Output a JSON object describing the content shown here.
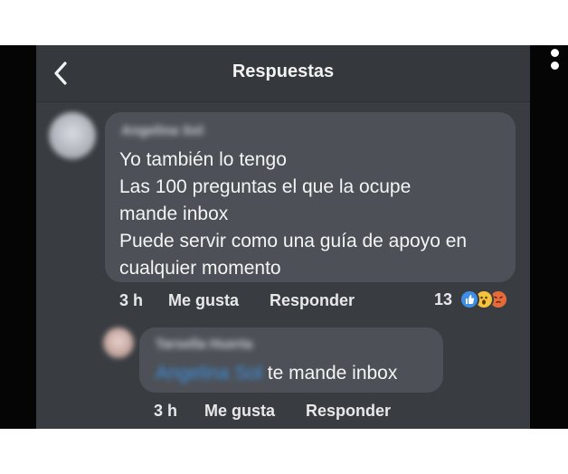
{
  "header": {
    "title": "Respuestas",
    "back_icon": "chevron-left-icon"
  },
  "comment": {
    "author_name": "Angelina Sol",
    "lines": [
      "Yo también lo tengo",
      "Las 100 preguntas el que la ocupe",
      "mande inbox",
      "Puede servir como una guía de apoyo en",
      "cualquier momento"
    ],
    "time": "3 h",
    "like_label": "Me gusta",
    "reply_label": "Responder",
    "reaction_count": "13",
    "reactions": [
      "like",
      "wow",
      "angry"
    ]
  },
  "reply": {
    "author_name": "Tarsella Huerta",
    "mention": "Angelina Sol",
    "text": "te mande inbox",
    "time": "3 h",
    "like_label": "Me gusta",
    "reply_label": "Responder"
  },
  "colors": {
    "screen_bg": "#393d42",
    "bubble_bg": "#4d5157",
    "mention": "#3d8fe0",
    "like_reaction": "#3d8fe6",
    "wow_reaction": "#f4c23c",
    "angry_reaction": "#e56b3a"
  }
}
